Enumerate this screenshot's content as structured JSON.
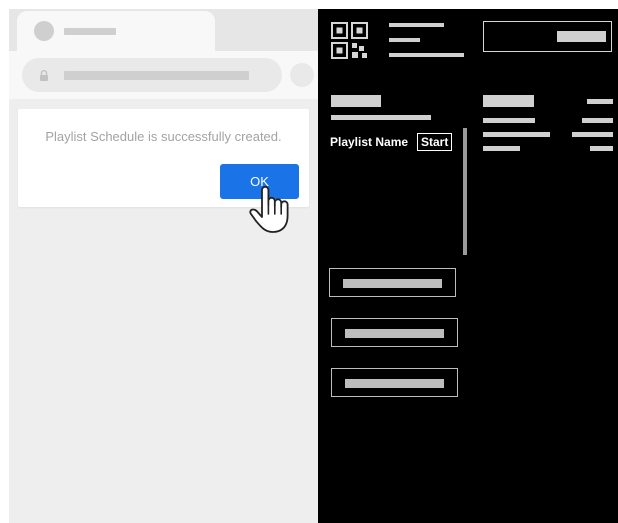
{
  "browser": {
    "dialog": {
      "message": "Playlist Schedule is successfully created.",
      "ok_label": "OK"
    }
  },
  "device_panel": {
    "playlist_name_label": "Playlist Name",
    "start_label": "Start"
  },
  "colors": {
    "accent_blue": "#1a74e8",
    "panel_background": "#000000",
    "browser_background": "#eeeeee",
    "placeholder_gray": "#cfcfcf"
  },
  "icons": [
    "lock-icon",
    "hand-cursor-icon",
    "qr-code-icon"
  ]
}
